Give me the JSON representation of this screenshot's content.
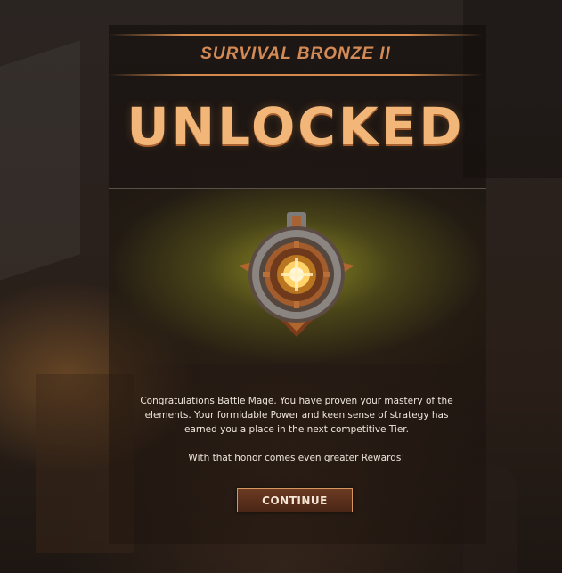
{
  "tier": {
    "title": "SURVIVAL BRONZE II"
  },
  "headline": "UNLOCKED",
  "emblem": {
    "icon": "bronze-rank-emblem-icon"
  },
  "message": {
    "paragraph1": "Congratulations Battle Mage. You have proven your mastery of the elements. Your formidable Power and keen sense of strategy has earned you a place in the next competitive Tier.",
    "paragraph2": "With that honor comes even greater Rewards!"
  },
  "actions": {
    "continue_label": "CONTINUE"
  },
  "colors": {
    "accent": "#d48a4e",
    "headline": "#f2b778",
    "button_bg": "#5a301c"
  }
}
